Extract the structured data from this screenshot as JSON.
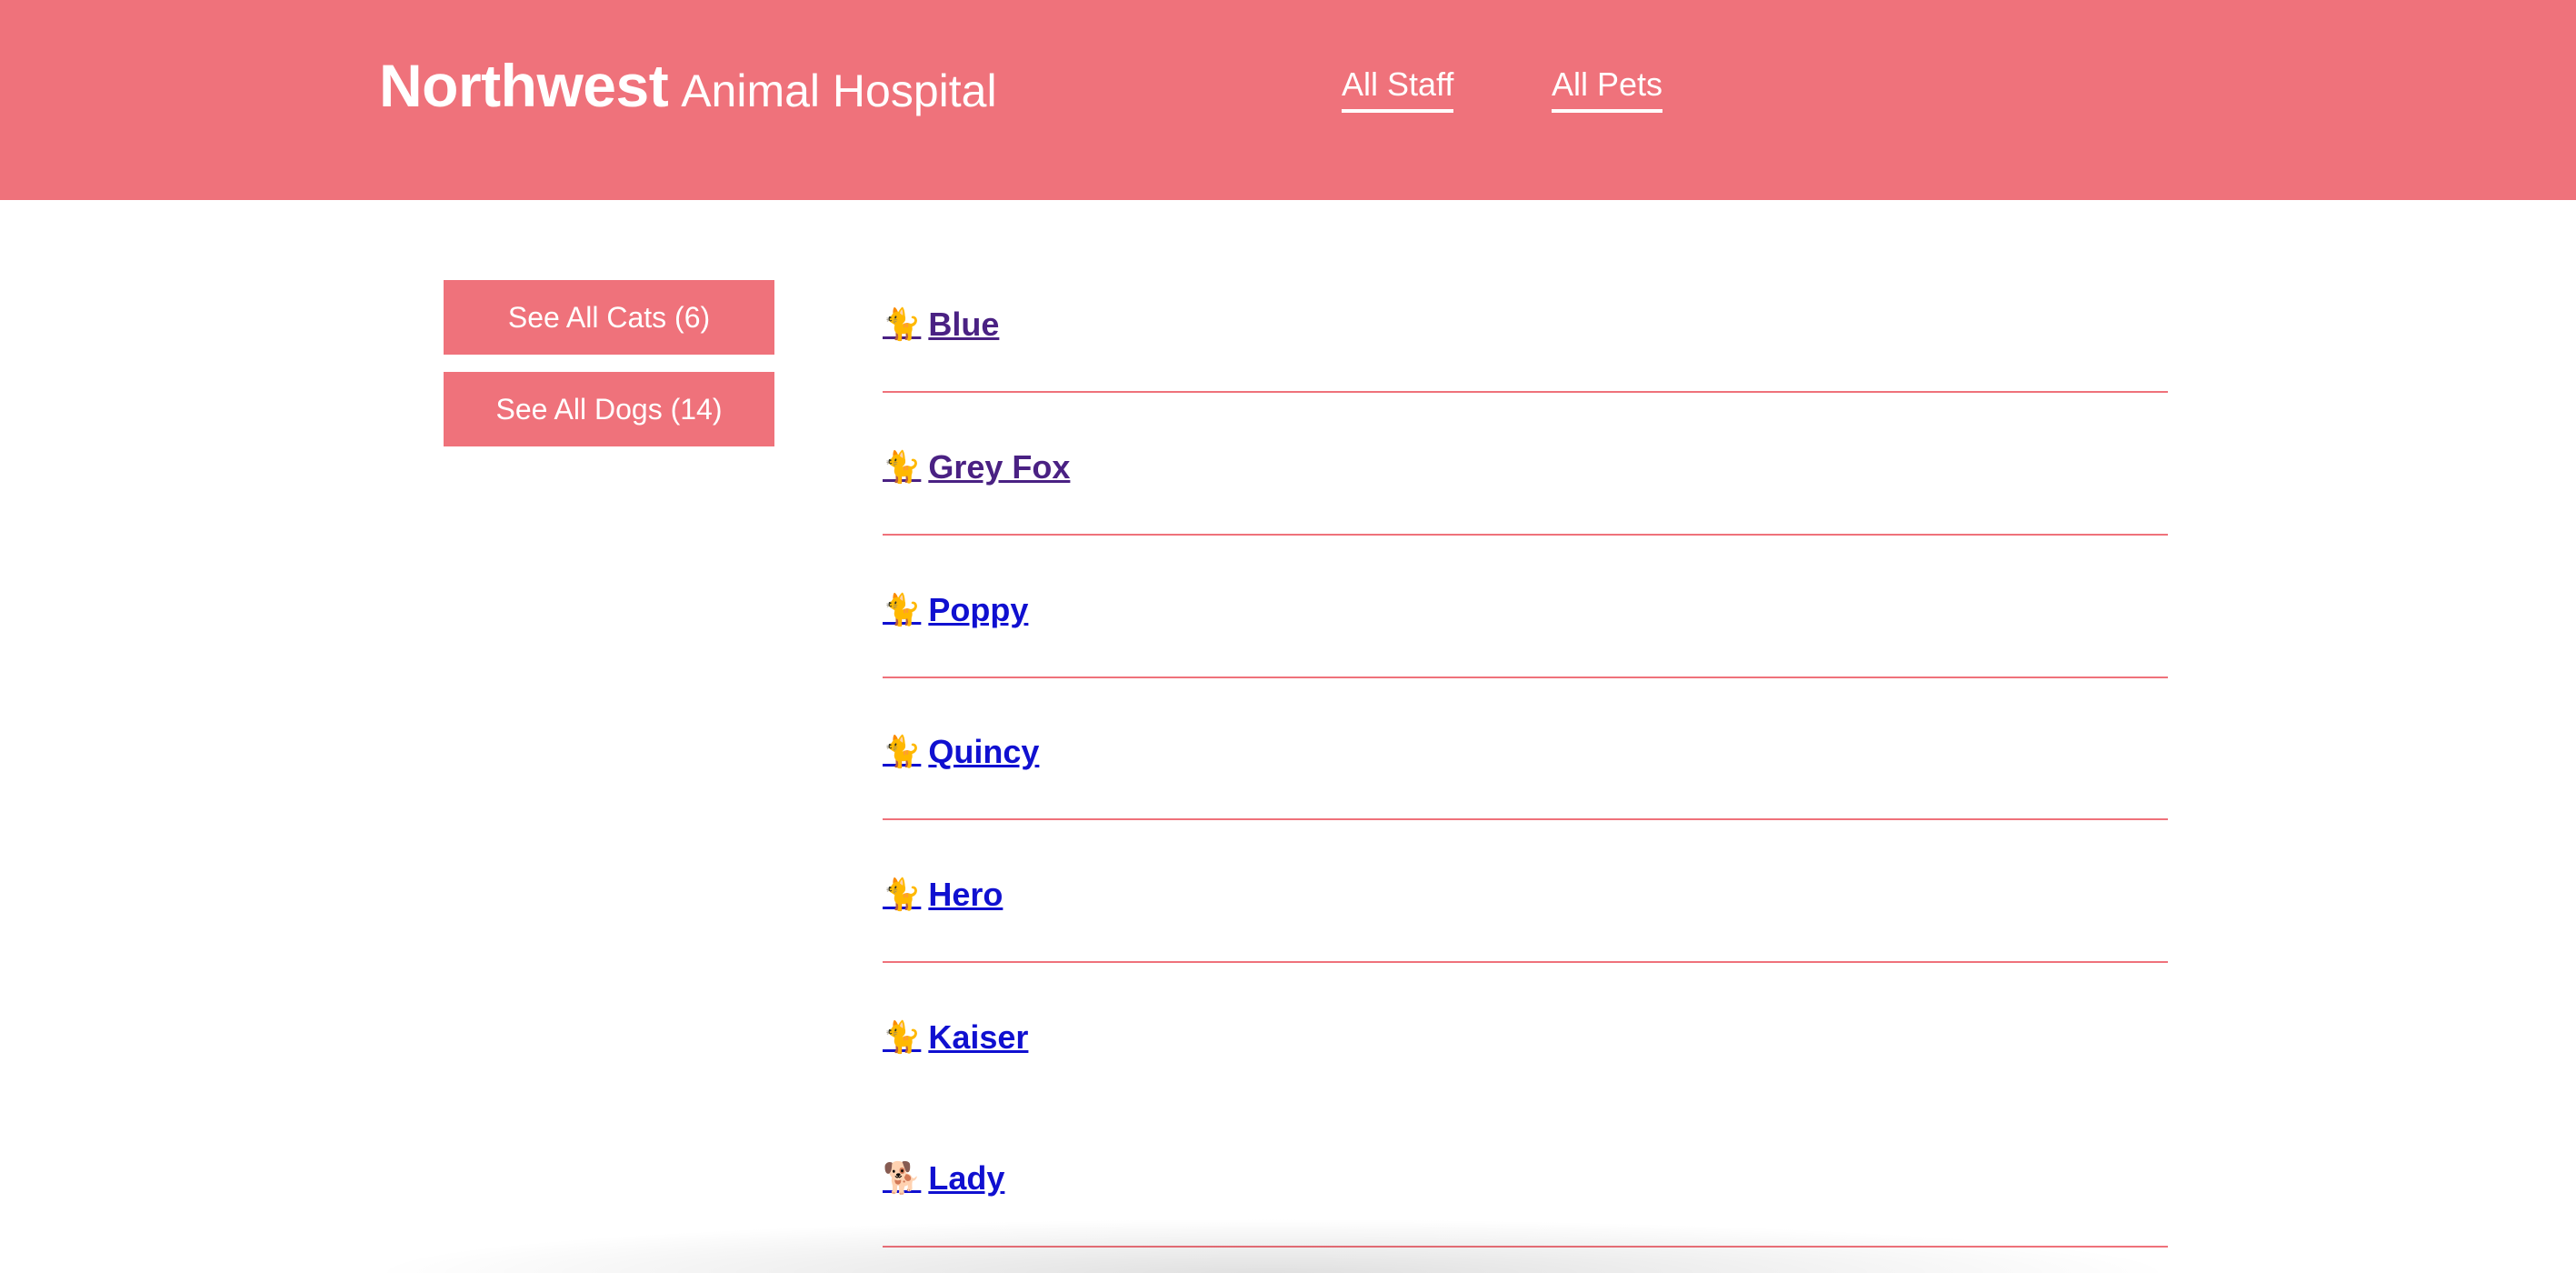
{
  "header": {
    "brand_main": "Northwest",
    "brand_sub": "Animal Hospital",
    "nav": [
      {
        "label": "All Staff"
      },
      {
        "label": "All Pets"
      }
    ]
  },
  "filters": {
    "cats_label": "See All Cats (6)",
    "dogs_label": "See All Dogs (14)"
  },
  "pets": [
    {
      "name": "Blue",
      "icon": "cat-icon",
      "glyph": "🐈",
      "visited": true
    },
    {
      "name": "Grey Fox",
      "icon": "cat-icon",
      "glyph": "🐈",
      "visited": true
    },
    {
      "name": "Poppy",
      "icon": "cat-icon",
      "glyph": "🐈",
      "visited": false
    },
    {
      "name": "Quincy",
      "icon": "cat-icon",
      "glyph": "🐈",
      "visited": false
    },
    {
      "name": "Hero",
      "icon": "cat-icon",
      "glyph": "🐈",
      "visited": false
    },
    {
      "name": "Kaiser",
      "icon": "cat-icon",
      "glyph": "🐈",
      "visited": false
    },
    {
      "name": "Lady",
      "icon": "dog-icon",
      "glyph": "🐕",
      "visited": false
    }
  ],
  "colors": {
    "brand": "#ef727b",
    "visited_link": "#4a2183",
    "link": "#1010d0"
  }
}
